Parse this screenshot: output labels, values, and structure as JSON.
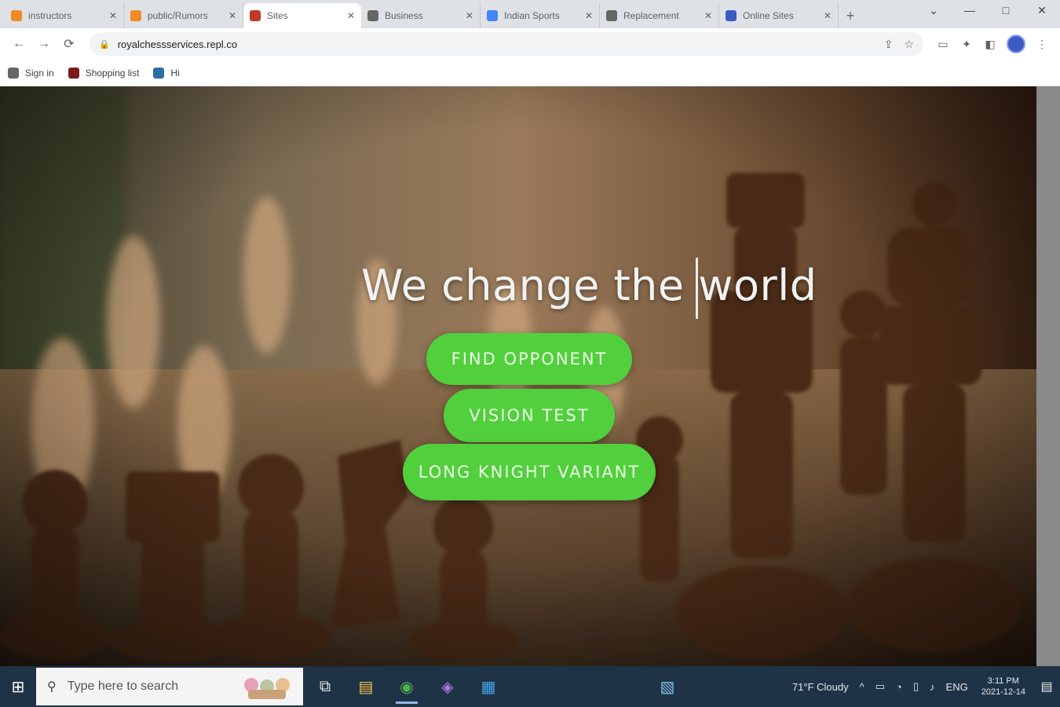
{
  "browser": {
    "tabs": [
      {
        "title": "instructors",
        "favicon_color": "#f08a24",
        "close": "✕"
      },
      {
        "title": "public/Rumors",
        "favicon_color": "#f08a24",
        "close": "✕"
      },
      {
        "title": "Sites",
        "favicon_color": "#c0392b",
        "close": "✕",
        "active": true
      },
      {
        "title": "Business",
        "favicon_color": "#666666",
        "close": "✕"
      },
      {
        "title": "Indian Sports",
        "favicon_color": "#4285f4",
        "close": "✕"
      },
      {
        "title": "Replacement",
        "favicon_color": "#666666",
        "close": "✕"
      },
      {
        "title": "Online Sites",
        "favicon_color": "#3b5cc4",
        "close": "✕"
      }
    ],
    "new_tab": "+",
    "window_controls": {
      "chevron": "⌄",
      "minimize": "—",
      "maximize": "□",
      "close": "✕"
    },
    "nav": {
      "back": "←",
      "forward": "→",
      "reload": "⟳"
    },
    "address": {
      "lock": "🔒",
      "url": "royalchessservices.repl.co"
    },
    "address_icons": {
      "share": "⇪",
      "star": "☆"
    },
    "toolbar_icons": {
      "cast": "▭",
      "extensions": "✦",
      "puzzle": "◧",
      "menu": "⋮"
    },
    "bookmarks": [
      {
        "label": "Sign in",
        "favicon_color": "#666666"
      },
      {
        "label": "Shopping list",
        "favicon_color": "#7a1a1a"
      },
      {
        "label": "Hi",
        "favicon_color": "#2b6fa8"
      }
    ]
  },
  "hero": {
    "title": "We change the world",
    "buttons": [
      "Find Opponent",
      "Vision Test",
      "Long Knight Variant"
    ],
    "colors": {
      "button": "#52cf3d",
      "button_text": "#eaffe4"
    }
  },
  "taskbar": {
    "start": "⊞",
    "search_placeholder": "Type here to search",
    "search_icon": "⚲",
    "apps": [
      {
        "name": "task-view-icon",
        "glyph": "⧉"
      },
      {
        "name": "file-explorer-icon",
        "glyph": "▤"
      },
      {
        "name": "chrome-icon",
        "glyph": "◉",
        "running": true
      },
      {
        "name": "app-icon",
        "glyph": "◈"
      },
      {
        "name": "store-icon",
        "glyph": "▦"
      },
      {
        "name": "folder-app-icon",
        "glyph": "▧"
      }
    ],
    "weather": "71°F Cloudy",
    "tray_glyphs": [
      "^",
      "▭",
      "◔",
      "▯",
      "♪",
      "ENG"
    ],
    "time": "3:11 PM",
    "date": "2021-12-14",
    "notification_glyph": "▤"
  }
}
